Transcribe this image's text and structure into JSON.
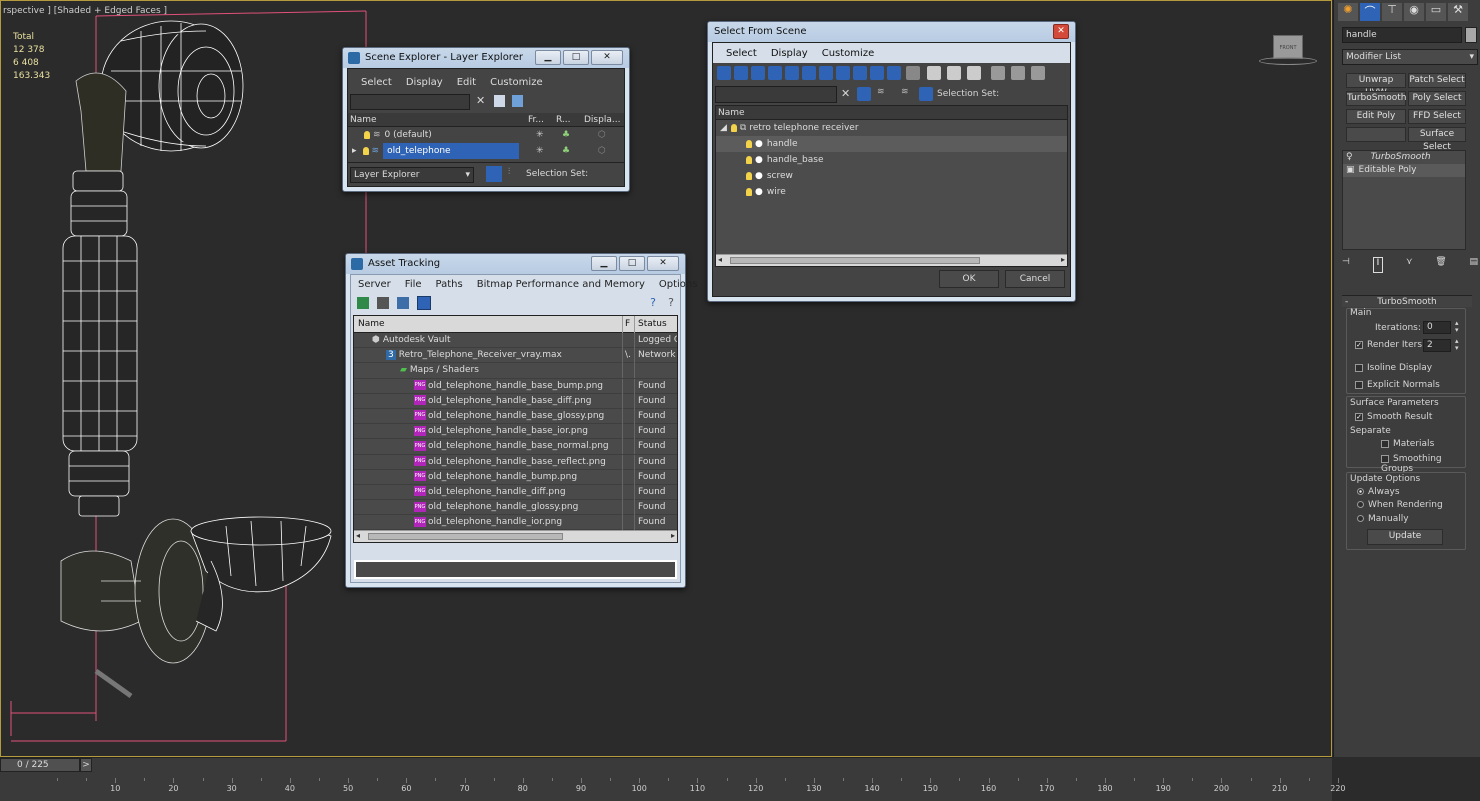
{
  "viewport": {
    "label": "rspective ] [Shaded + Edged Faces ]",
    "stats": [
      "Total",
      "12 378",
      "6 408",
      "",
      "163.343"
    ],
    "viewcube_label": "FRONT"
  },
  "scene_explorer": {
    "title": "Scene Explorer - Layer Explorer",
    "menu": [
      "Select",
      "Display",
      "Edit",
      "Customize"
    ],
    "columns": [
      "Name",
      "Fr...",
      "R...",
      "Displa..."
    ],
    "rows": [
      {
        "name": "0 (default)",
        "selected": false
      },
      {
        "name": "old_telephone",
        "selected": true
      }
    ],
    "footer_dropdown": "Layer Explorer",
    "selection_set_label": "Selection Set:"
  },
  "select_from_scene": {
    "title": "Select From Scene",
    "menu": [
      "Select",
      "Display",
      "Customize"
    ],
    "selection_set_label": "Selection Set:",
    "column": "Name",
    "root": "retro telephone receiver",
    "items": [
      "handle",
      "handle_base",
      "screw",
      "wire"
    ],
    "ok_label": "OK",
    "cancel_label": "Cancel"
  },
  "asset_tracking": {
    "title": "Asset Tracking",
    "menu": [
      "Server",
      "File",
      "Paths",
      "Bitmap Performance and Memory",
      "Options"
    ],
    "columns": [
      "Name",
      "F",
      "Status"
    ],
    "rows": [
      {
        "name": "Autodesk Vault",
        "f": "",
        "status": "Logged O",
        "indent": 0,
        "icon": "vault"
      },
      {
        "name": "Retro_Telephone_Receiver_vray.max",
        "f": "\\.",
        "status": "Network",
        "indent": 1,
        "icon": "max"
      },
      {
        "name": "Maps / Shaders",
        "f": "",
        "status": "",
        "indent": 2,
        "icon": "maps"
      },
      {
        "name": "old_telephone_handle_base_bump.png",
        "f": "",
        "status": "Found",
        "indent": 3,
        "icon": "png"
      },
      {
        "name": "old_telephone_handle_base_diff.png",
        "f": "",
        "status": "Found",
        "indent": 3,
        "icon": "png"
      },
      {
        "name": "old_telephone_handle_base_glossy.png",
        "f": "",
        "status": "Found",
        "indent": 3,
        "icon": "png"
      },
      {
        "name": "old_telephone_handle_base_ior.png",
        "f": "",
        "status": "Found",
        "indent": 3,
        "icon": "png"
      },
      {
        "name": "old_telephone_handle_base_normal.png",
        "f": "",
        "status": "Found",
        "indent": 3,
        "icon": "png"
      },
      {
        "name": "old_telephone_handle_base_reflect.png",
        "f": "",
        "status": "Found",
        "indent": 3,
        "icon": "png"
      },
      {
        "name": "old_telephone_handle_bump.png",
        "f": "",
        "status": "Found",
        "indent": 3,
        "icon": "png"
      },
      {
        "name": "old_telephone_handle_diff.png",
        "f": "",
        "status": "Found",
        "indent": 3,
        "icon": "png"
      },
      {
        "name": "old_telephone_handle_glossy.png",
        "f": "",
        "status": "Found",
        "indent": 3,
        "icon": "png"
      },
      {
        "name": "old_telephone_handle_ior.png",
        "f": "",
        "status": "Found",
        "indent": 3,
        "icon": "png"
      }
    ],
    "png_badge": "PNG"
  },
  "command_panel": {
    "object_name": "handle",
    "modifier_list": "Modifier List",
    "buttons": [
      "Unwrap UVW",
      "Patch Select",
      "TurboSmooth",
      "Poly Select",
      "Edit Poly",
      "FFD Select",
      "",
      "Surface Select"
    ],
    "stack": [
      "TurboSmooth",
      "Editable Poly"
    ],
    "rollout_title": "TurboSmooth",
    "main_label": "Main",
    "iterations_label": "Iterations:",
    "iterations_value": "0",
    "render_iters_label": "Render Iters:",
    "render_iters_value": "2",
    "isoline_label": "Isoline Display",
    "explicit_normals_label": "Explicit Normals",
    "surface_params_label": "Surface Parameters",
    "smooth_result_label": "Smooth Result",
    "separate_label": "Separate",
    "materials_label": "Materials",
    "smoothing_groups_label": "Smoothing Groups",
    "update_options_label": "Update Options",
    "always_label": "Always",
    "when_rendering_label": "When Rendering",
    "manually_label": "Manually",
    "update_button": "Update"
  },
  "timeline": {
    "frame": "0 / 225",
    "next": ">",
    "ticks": [
      10,
      20,
      30,
      40,
      50,
      60,
      70,
      80,
      90,
      100,
      110,
      120,
      130,
      140,
      150,
      160,
      170,
      180,
      190,
      200,
      210,
      220
    ],
    "frame_max": 225
  },
  "colors": {
    "accent": "#2f63b5",
    "viewport_border": "#b59a3e",
    "wire": "#ffffff",
    "bbox": "#e0507a"
  }
}
